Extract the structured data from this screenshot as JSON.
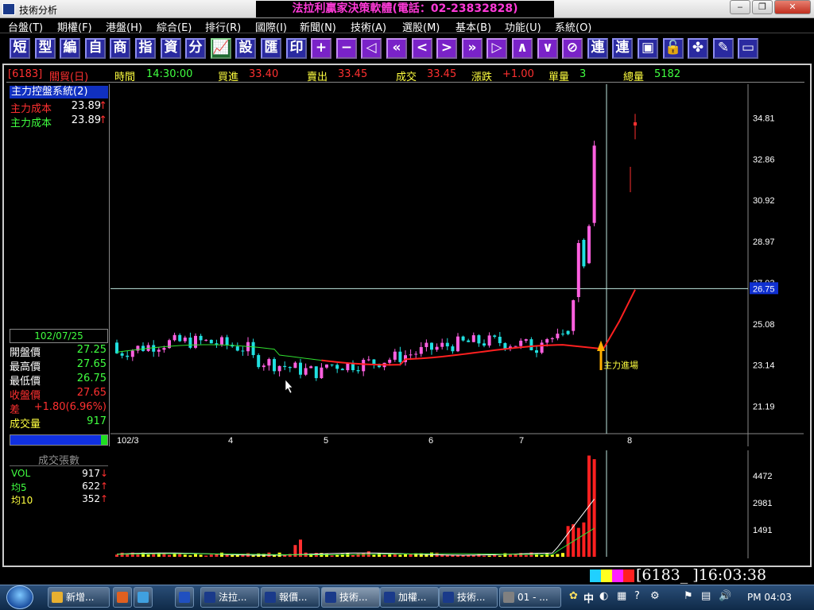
{
  "window": {
    "title": "技術分析",
    "banner": "法拉利贏家決策軟體(電話：02-23832828)",
    "controls": [
      "‒",
      "❐",
      "✕"
    ]
  },
  "menu": [
    {
      "label": "台盤(T)"
    },
    {
      "label": "期權(F)"
    },
    {
      "label": "港盤(H)"
    },
    {
      "label": "綜合(E)"
    },
    {
      "label": "排行(R)"
    },
    {
      "label": "國際(I)"
    },
    {
      "label": "新聞(N)"
    },
    {
      "label": "技術(A)"
    },
    {
      "label": "選股(M)"
    },
    {
      "label": "基本(B)"
    },
    {
      "label": "功能(U)"
    },
    {
      "label": "系統(O)"
    }
  ],
  "toolbar": [
    {
      "label": "短",
      "icon": "short-icon"
    },
    {
      "label": "型",
      "icon": "pattern-icon"
    },
    {
      "label": "編",
      "icon": "edit-icon"
    },
    {
      "label": "自",
      "icon": "custom-icon"
    },
    {
      "label": "商",
      "icon": "product-icon"
    },
    {
      "label": "指",
      "icon": "index-icon"
    },
    {
      "label": "資",
      "icon": "data-icon"
    },
    {
      "label": "分",
      "icon": "minute-icon"
    },
    {
      "label": "📈",
      "icon": "chart-icon"
    },
    {
      "label": "設",
      "icon": "settings-icon"
    },
    {
      "label": "匯",
      "icon": "export-icon"
    },
    {
      "label": "印",
      "icon": "print-icon"
    },
    {
      "label": "+",
      "icon": "zoom-in-icon"
    },
    {
      "label": "−",
      "icon": "zoom-out-icon"
    },
    {
      "label": "◁",
      "icon": "first-icon"
    },
    {
      "label": "«",
      "icon": "fast-back-icon"
    },
    {
      "label": "<",
      "icon": "back-icon"
    },
    {
      "label": ">",
      "icon": "forward-icon"
    },
    {
      "label": "»",
      "icon": "fast-forward-icon"
    },
    {
      "label": "▷",
      "icon": "last-icon"
    },
    {
      "label": "∧",
      "icon": "up-icon"
    },
    {
      "label": "∨",
      "icon": "down-icon"
    },
    {
      "label": "⊘",
      "icon": "esc-icon"
    },
    {
      "label": "連",
      "icon": "link-icon"
    },
    {
      "label": "連",
      "icon": "link2-icon"
    },
    {
      "label": "▣",
      "icon": "window-icon"
    },
    {
      "label": "🔓",
      "icon": "lock-icon"
    },
    {
      "label": "✤",
      "icon": "tools-icon"
    },
    {
      "label": "✎",
      "icon": "pen-icon"
    },
    {
      "label": "▭",
      "icon": "frame-icon"
    }
  ],
  "infobar": {
    "symbol": "[6183]",
    "name": "關貿(日)",
    "time_label": "時間",
    "time": "14:30:00",
    "bid_label": "買進",
    "bid": "33.40",
    "ask_label": "賣出",
    "ask": "33.45",
    "last_label": "成交",
    "last": "33.45",
    "change_label": "漲跌",
    "change": "+1.00",
    "unit_vol_label": "單量",
    "unit_vol": "3",
    "total_vol_label": "總量",
    "total_vol": "5182"
  },
  "indicator_panel": {
    "title": "主力控盤系統(2)",
    "rows": [
      {
        "label": "主力成本",
        "value": "23.89",
        "arrow": "↑",
        "color": "#ff3030"
      },
      {
        "label": "主力成本",
        "value": "23.89",
        "arrow": "↑",
        "color": "#40ff40"
      }
    ]
  },
  "quote_panel": {
    "date": "102/07/25",
    "rows": [
      {
        "label": "開盤價",
        "value": "27.25",
        "label_color": "#ffffff",
        "value_color": "#40ff40"
      },
      {
        "label": "最高價",
        "value": "27.65",
        "label_color": "#ffffff",
        "value_color": "#40ff40"
      },
      {
        "label": "最低價",
        "value": "26.75",
        "label_color": "#ffffff",
        "value_color": "#40ff40"
      },
      {
        "label": "收盤價",
        "value": "27.65",
        "label_color": "#ff3030",
        "value_color": "#ff3030"
      },
      {
        "label": "差",
        "value": "+1.80(6.96%)",
        "label_color": "#ff3030",
        "value_color": "#ff3030"
      },
      {
        "label": "成交量",
        "value": "917",
        "label_color": "#ffff40",
        "value_color": "#40ff40"
      }
    ]
  },
  "volume_panel": {
    "title": "成交張數",
    "rows": [
      {
        "label": "VOL",
        "value": "917",
        "arrow": "↓",
        "label_color": "#40ff40",
        "value_color": "#ffffff"
      },
      {
        "label": "均5",
        "value": "622",
        "arrow": "↑",
        "label_color": "#40ff40",
        "value_color": "#ffffff"
      },
      {
        "label": "均10",
        "value": "352",
        "arrow": "↑",
        "label_color": "#ffff40",
        "value_color": "#ffffff"
      }
    ]
  },
  "chart_data": [
    {
      "type": "candlestick",
      "y_ticks": [
        "34.81",
        "32.86",
        "30.92",
        "28.97",
        "27.03",
        "25.08",
        "23.14",
        "21.19"
      ],
      "crosshair_price": "26.75",
      "x_ticks": [
        "102/3",
        "4",
        "5",
        "6",
        "7",
        "8"
      ],
      "annotation": "主力進場",
      "ylim": [
        19.9,
        36.4
      ]
    },
    {
      "type": "bar",
      "y_ticks": [
        "4472",
        "2981",
        "1491"
      ],
      "ylim": [
        0,
        5800
      ]
    }
  ],
  "statusbar": {
    "code": "[6183_  ]16:03:38",
    "strip_colors": [
      "#20d0ff",
      "#ffff20",
      "#ff20ff",
      "#ff2020"
    ]
  },
  "taskbar": {
    "buttons": [
      {
        "label": "新增...",
        "color": "#e8b030"
      },
      {
        "label": "",
        "color": "#e06020"
      },
      {
        "label": "",
        "color": "#40a0e0"
      },
      {
        "label": "",
        "color": "#2050c0"
      },
      {
        "label": "法拉...",
        "color": "#1a3a8a"
      },
      {
        "label": "報價...",
        "color": "#1a3a8a"
      },
      {
        "label": "技術...",
        "color": "#1a3a8a"
      },
      {
        "label": "加權...",
        "color": "#1a3a8a"
      },
      {
        "label": "技術...",
        "color": "#1a3a8a"
      },
      {
        "label": "01 - ...",
        "color": "#808080"
      }
    ],
    "tray_lang": "中",
    "clock": "PM 04:03"
  }
}
